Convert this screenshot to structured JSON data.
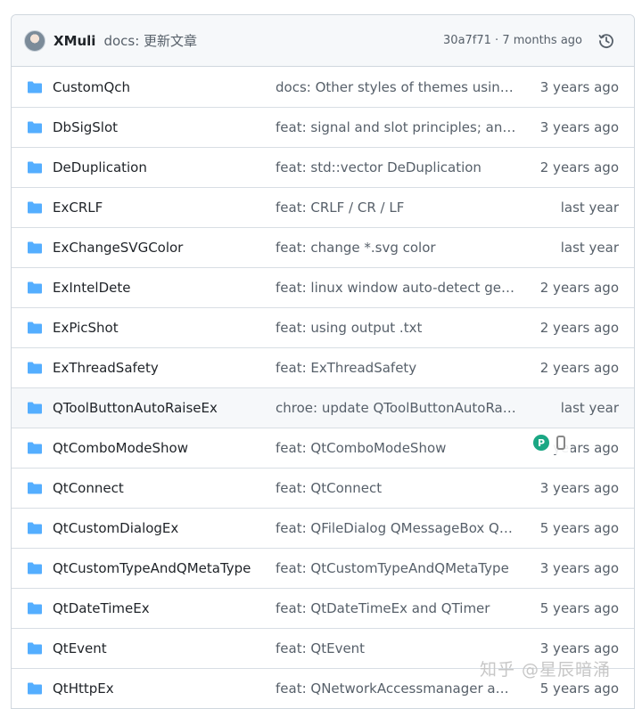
{
  "commit": {
    "author": "XMuli",
    "message": "docs: 更新文章",
    "meta": "30a7f71 · 7 months ago"
  },
  "rows": [
    {
      "name": "CustomQch",
      "message": "docs: Other styles of themes using ...",
      "age": "3 years ago"
    },
    {
      "name": "DbSigSlot",
      "message": "feat: signal and slot principles; and ...",
      "age": "3 years ago"
    },
    {
      "name": "DeDuplication",
      "message": "feat: std::vector DeDuplication",
      "age": "2 years ago"
    },
    {
      "name": "ExCRLF",
      "message": "feat: CRLF / CR / LF",
      "age": "last year"
    },
    {
      "name": "ExChangeSVGColor",
      "message": "feat: change *.svg color",
      "age": "last year"
    },
    {
      "name": "ExIntelDete",
      "message": "feat: linux window auto-detect get r...",
      "age": "2 years ago"
    },
    {
      "name": "ExPicShot",
      "message": "feat: using output .txt",
      "age": "2 years ago"
    },
    {
      "name": "ExThreadSafety",
      "message": "feat: ExThreadSafety",
      "age": "2 years ago"
    },
    {
      "name": "QToolButtonAutoRaiseEx",
      "message": "chroe: update QToolButtonAutoRai...",
      "age": "last year"
    },
    {
      "name": "QtComboModeShow",
      "message": "feat: QtComboModeShow",
      "age": "years ago"
    },
    {
      "name": "QtConnect",
      "message": "feat: QtConnect",
      "age": "3 years ago"
    },
    {
      "name": "QtCustomDialogEx",
      "message": "feat: QFileDialog QMessageBox QIn...",
      "age": "5 years ago"
    },
    {
      "name": "QtCustomTypeAndQMetaType",
      "message": "feat: QtCustomTypeAndQMetaType",
      "age": "3 years ago"
    },
    {
      "name": "QtDateTimeEx",
      "message": "feat: QtDateTimeEx and QTimer",
      "age": "5 years ago"
    },
    {
      "name": "QtEvent",
      "message": "feat: QtEvent",
      "age": "3 years ago"
    },
    {
      "name": "QtHttpEx",
      "message": "feat: QNetworkAccessmanager and ...",
      "age": "5 years ago"
    }
  ],
  "watermark": "知乎 @星辰暗涌",
  "colors": {
    "folder": "#54aeff",
    "border": "#d0d7de",
    "muted": "#57606a"
  },
  "icons": {
    "history": "history-icon",
    "folder": "folder-icon"
  }
}
